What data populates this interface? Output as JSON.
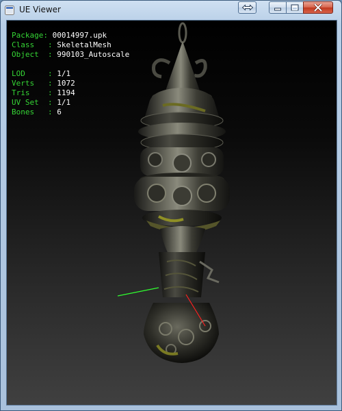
{
  "window": {
    "title": "UE Viewer",
    "icon": "app-icon",
    "buttons": [
      "swap-icon",
      "minimize-icon",
      "maximize-icon",
      "close-icon"
    ]
  },
  "info": {
    "package_key": "Package",
    "package_value": "00014997.upk",
    "class_key": "Class",
    "class_value": "SkeletalMesh",
    "object_key": "Object",
    "object_value": "990103_Autoscale",
    "lod_key": "LOD",
    "lod_value": "1/1",
    "verts_key": "Verts",
    "verts_value": "1072",
    "tris_key": "Tris",
    "tris_value": "1194",
    "uvset_key": "UV Set",
    "uvset_value": "1/1",
    "bones_key": "Bones",
    "bones_value": "6"
  },
  "colors": {
    "label": "#35d535",
    "value": "#ffffff",
    "axis_x": "#ff2020",
    "axis_y": "#30ff30"
  }
}
